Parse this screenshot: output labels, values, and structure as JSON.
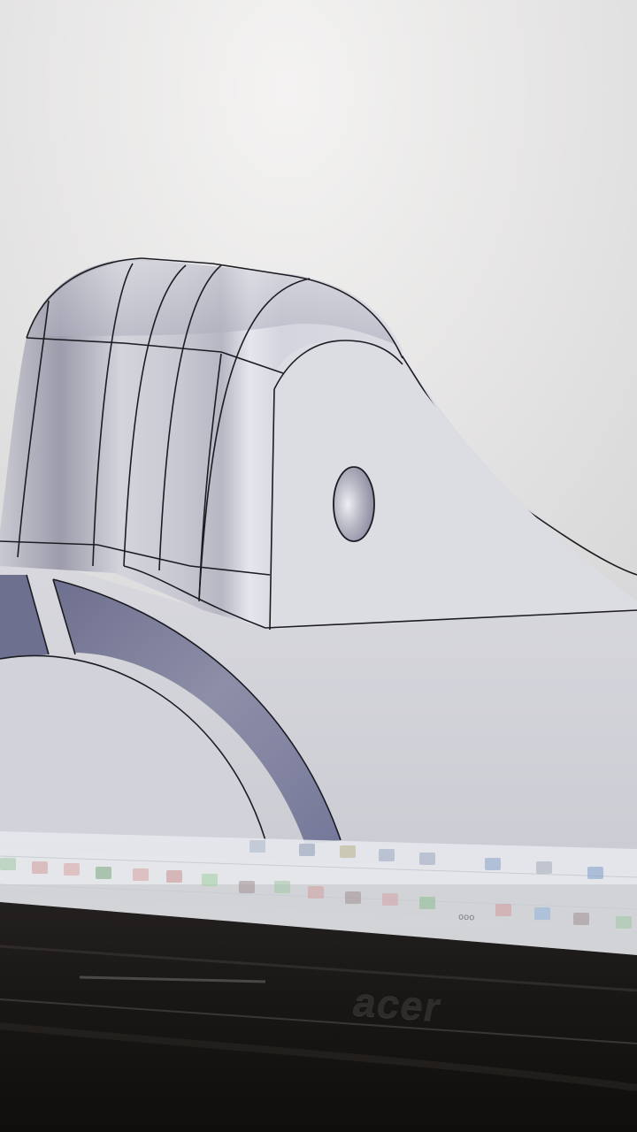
{
  "laptop": {
    "brand_text": "acer"
  },
  "toolbar": {
    "small_label": "ooo"
  },
  "colors": {
    "screen_background": "#e4e3e3",
    "model_surface": "#d8d8de",
    "model_shadow": "#6e7090",
    "outline": "#1c1c22",
    "bezel": "#161412"
  },
  "icons": [
    "view-cube-icon",
    "orbit-icon",
    "pan-icon",
    "zoom-icon",
    "display-mode-icon",
    "grid-icon",
    "viewports-icon"
  ]
}
